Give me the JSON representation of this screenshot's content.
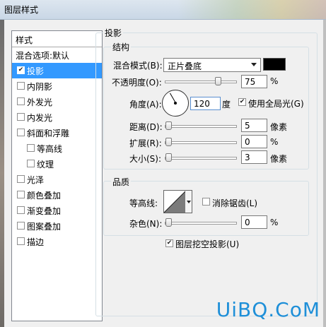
{
  "window": {
    "title": "图层样式"
  },
  "sidebar": {
    "header": "样式",
    "blend_default": "混合选项:默认",
    "items": [
      {
        "label": "投影",
        "checked": true,
        "selected": true
      },
      {
        "label": "内阴影",
        "checked": false
      },
      {
        "label": "外发光",
        "checked": false
      },
      {
        "label": "内发光",
        "checked": false
      },
      {
        "label": "斜面和浮雕",
        "checked": false
      },
      {
        "label": "等高线",
        "checked": false
      },
      {
        "label": "纹理",
        "checked": false
      },
      {
        "label": "光泽",
        "checked": false
      },
      {
        "label": "颜色叠加",
        "checked": false
      },
      {
        "label": "渐变叠加",
        "checked": false
      },
      {
        "label": "图案叠加",
        "checked": false
      },
      {
        "label": "描边",
        "checked": false
      }
    ]
  },
  "panel": {
    "title": "投影",
    "structure": {
      "title": "结构",
      "blend_mode_label": "混合模式(B):",
      "blend_mode_value": "正片叠底",
      "shadow_color": "#000000",
      "opacity_label": "不透明度(O):",
      "opacity_value": "75",
      "opacity_level": 0.75,
      "angle_label": "角度(A):",
      "angle_value": "120",
      "angle_unit": "度",
      "global_light_label": "使用全局光(G)",
      "global_light_checked": true,
      "distance_label": "距离(D):",
      "distance_value": "5",
      "distance_unit": "像素",
      "spread_label": "扩展(R):",
      "spread_value": "0",
      "spread_unit": "%",
      "size_label": "大小(S):",
      "size_value": "3",
      "size_unit": "像素",
      "percent_unit": "%"
    },
    "quality": {
      "title": "品质",
      "contour_label": "等高线:",
      "antialias_label": "消除锯齿(L)",
      "antialias_checked": false,
      "noise_label": "杂色(N):",
      "noise_value": "0",
      "noise_unit": "%"
    },
    "knockout_label": "图层挖空投影(U)",
    "knockout_checked": true
  },
  "watermark": "UiBQ.CoM"
}
